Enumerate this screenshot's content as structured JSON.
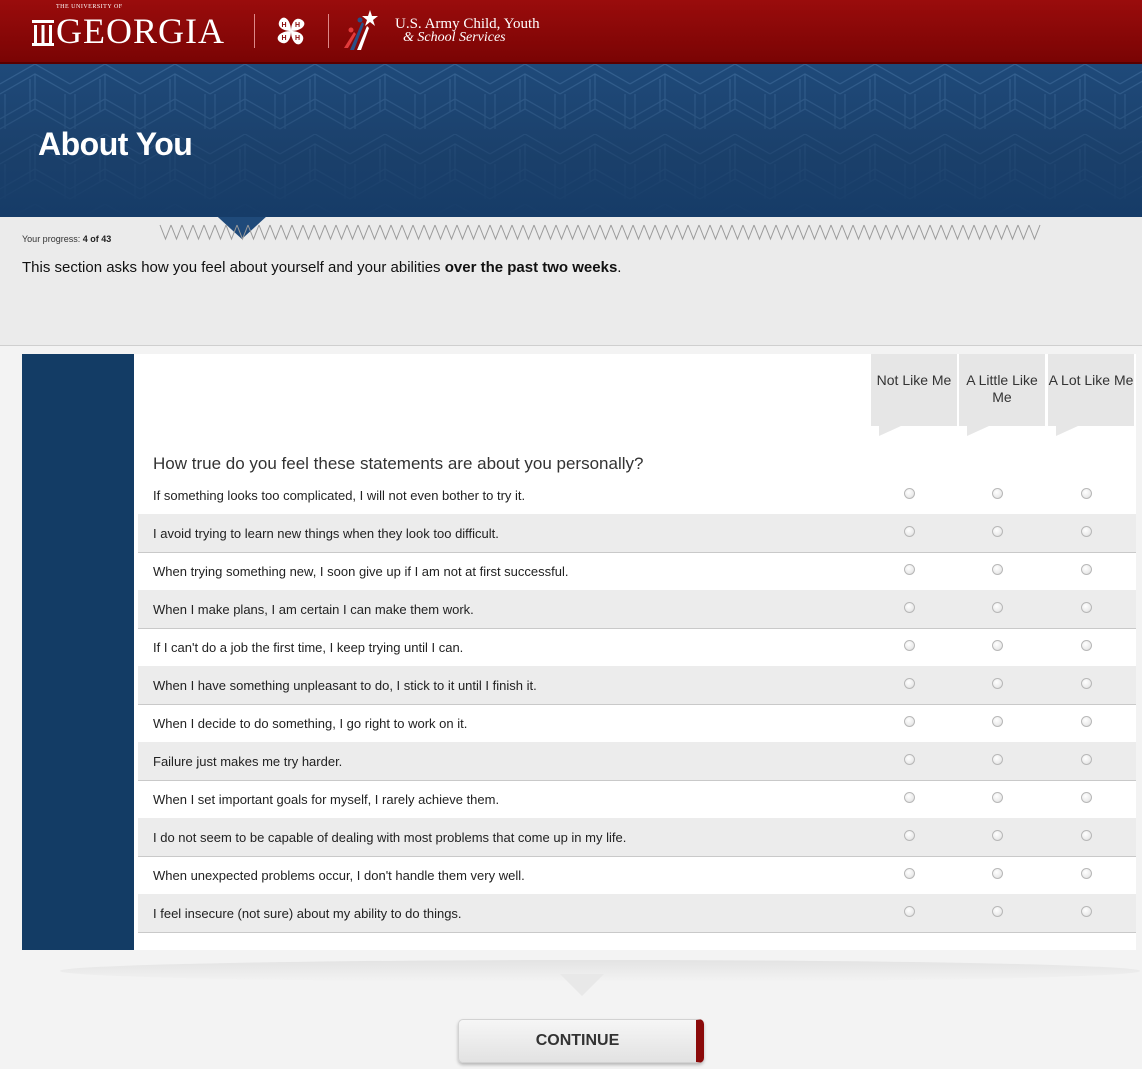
{
  "header": {
    "university_small": "THE UNIVERSITY OF",
    "university_name": "GEORGIA",
    "partner_line1": "U.S. Army Child, Youth",
    "partner_line2": "& School Services"
  },
  "hero": {
    "title": "About You"
  },
  "progress": {
    "label": "Your progress:",
    "value": "4 of 43",
    "current": 4,
    "total": 43
  },
  "intro": {
    "text": "This section asks how you feel about yourself and your abilities ",
    "emphasis": "over the past two weeks",
    "end": "."
  },
  "survey": {
    "columns": [
      {
        "label": "Not Like Me"
      },
      {
        "label": "A Little Like Me"
      },
      {
        "label": "A Lot Like Me"
      }
    ],
    "question": "How true do you feel these statements are about you personally?",
    "statements": [
      "If something looks too complicated, I will not even bother to try it.",
      "I avoid trying to learn new things when they look too difficult.",
      "When trying something new, I soon give up if I am not at first successful.",
      "When I make plans, I am certain I can make them work.",
      "If I can't do a job the first time, I keep trying until I can.",
      "When I have something unpleasant to do, I stick to it until I finish it.",
      "When I decide to do something, I go right to work on it.",
      "Failure just makes me try harder.",
      "When I set important goals for myself, I rarely achieve them.",
      "I do not seem to be capable of dealing with most problems that come up in my life.",
      "When unexpected problems occur, I don't handle them very well.",
      "I feel insecure (not sure) about my ability to do things."
    ]
  },
  "footer": {
    "continue_label": "CONTINUE"
  },
  "colors": {
    "header_red": "#8b0a0a",
    "hero_blue": "#1f4a7a",
    "stripe_navy": "#133c65"
  }
}
